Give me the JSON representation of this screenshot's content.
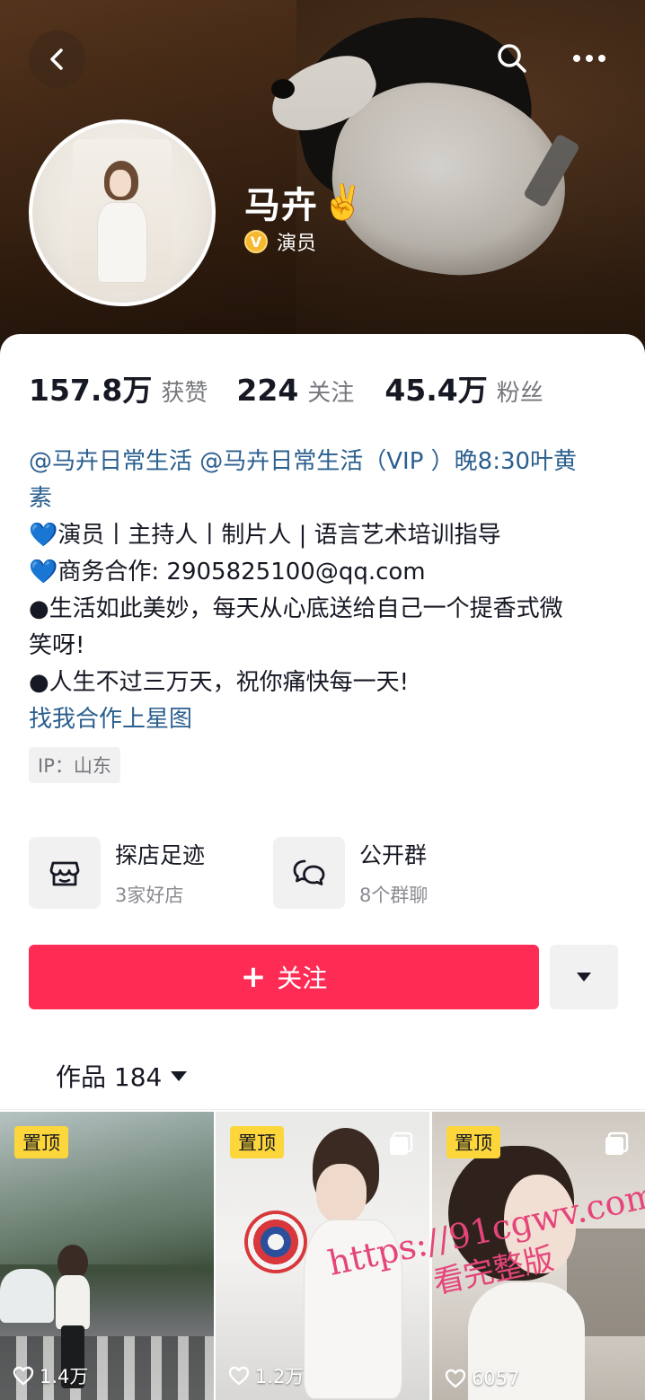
{
  "header": {
    "name": "马卉",
    "name_emoji": "✌️",
    "role": "演员",
    "verified_badge": "V"
  },
  "stats": [
    {
      "value": "157.8万",
      "label": "获赞"
    },
    {
      "value": "224",
      "label": "关注"
    },
    {
      "value": "45.4万",
      "label": "粉丝"
    }
  ],
  "bio": {
    "line1": "@马卉日常生活 @马卉日常生活（VIP ）晚8:30叶黄",
    "line1b": "素",
    "line2": "💙演员丨主持人丨制片人 | 语言艺术培训指导",
    "line3": "💙商务合作: 2905825100@qq.com",
    "line4": "●生活如此美妙，每天从心底送给自己一个提香式微",
    "line4b": "笑呀!",
    "line5": "●人生不过三万天，祝你痛快每一天!",
    "line6": "找我合作上星图"
  },
  "ip_tag": "IP：山东",
  "cards": [
    {
      "title": "探店足迹",
      "subtitle": "3家好店",
      "icon": "store-icon"
    },
    {
      "title": "公开群",
      "subtitle": "8个群聊",
      "icon": "chat-bubbles-icon"
    }
  ],
  "actions": {
    "follow_label": "关注",
    "follow_color": "#fe2c55"
  },
  "works_tab": {
    "label": "作品 184"
  },
  "videos": [
    {
      "pinned": "置顶",
      "likes": "1.4万",
      "multi": false
    },
    {
      "pinned": "置顶",
      "likes": "1.2万",
      "multi": true
    },
    {
      "pinned": "置顶",
      "likes": "6057",
      "multi": true
    }
  ],
  "watermark": {
    "line1": "https://91cgwv.com",
    "line2": "看完整版"
  },
  "colors": {
    "accent": "#fe2c55",
    "link": "#2b5f8f",
    "pin_badge": "#fcd63a"
  }
}
